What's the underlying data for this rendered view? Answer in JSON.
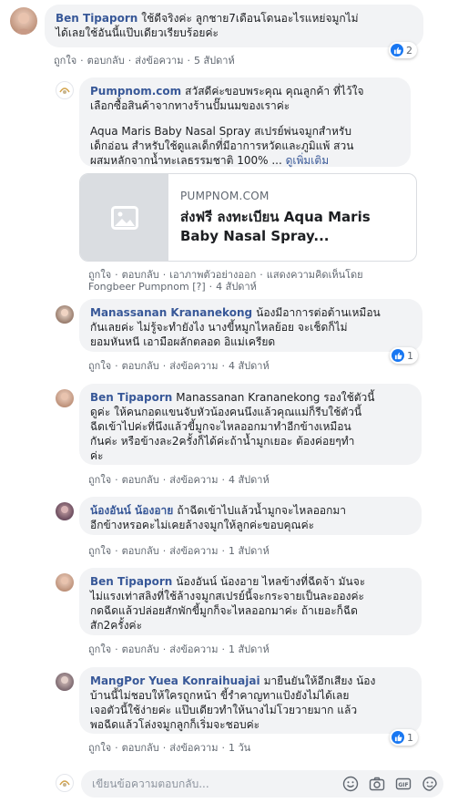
{
  "colors": {
    "link": "#385898",
    "meta": "#606770",
    "bubble": "#f2f3f5",
    "like": "#1877f2"
  },
  "actions": {
    "like": "ถูกใจ",
    "reply": "ตอบกลับ",
    "report": "ส่งข้อความ"
  },
  "comments": [
    {
      "author": "Ben Tipaporn",
      "text_lines": [
        "ใช้ดีจริงค่ะ ลูกชาย7เดือนโดนอะไรแหย่จมูกไม่",
        "ได้เลยใช้อันนี้แป๊บเดียวเรียบร้อยค่ะ"
      ],
      "time": "5 สัปดาห์",
      "reactions": "2"
    },
    {
      "author": "Pumpnom.com",
      "text_lines": [
        "สวัสดีค่ะขอบพระคุณ คุณลูกค้า ที่ไว้ใจ",
        "เลือกซื้อสินค้าจากทางร้านปั๊มนมของเราค่ะ"
      ],
      "para_lines": [
        "Aqua Maris Baby Nasal Spray สเปรย์พ่นจมูกสำหรับ",
        "เด็กอ่อน สำหรับใช้ดูแลเด็กที่มีอาการหวัดและภูมิแพ้ สวน",
        "ผสมหลักจากน้ำทะเลธรรมชาติ 100% ..."
      ],
      "see_more": "ดูเพิ่มเติม",
      "link_card": {
        "domain": "PUMPNOM.COM",
        "title_lines": [
          "ส่งฟรี ลงทะเบียน Aqua Maris",
          "Baby Nasal Spray..."
        ]
      },
      "extra_actions": {
        "preview": "เอาภาพตัวอย่างออก",
        "translate": "แสดงความคิดเห็นโดย"
      },
      "signature": "Fongbeer Pumpnom",
      "sig_tag": "[?]",
      "time": "4 สัปดาห์"
    },
    {
      "author": "Manassanan Krananekong",
      "text_lines": [
        "น้องมีอาการต่อต้านเหมือน",
        "กันเลยค่ะ ไม่รู้จะทำยังไง นางขี้หมูกไหลย้อย จะเช็ดก็ไม่",
        "ยอมหันหนี เอามือผลักตลอด อิแม่เครียด"
      ],
      "time": "4 สัปดาห์",
      "reactions": "1"
    },
    {
      "author": "Ben Tipaporn",
      "text_lines": [
        "Manassanan Krananekong รองใช้ตัวนี้",
        "ดูค่ะ ให้คนกอดแขนจับหัวน้องคนนึงแล้วคุณแม่ก็รีบใช้ตัวนี้",
        "ฉีดเข้าไปค่ะที่นึงแล้วขี้มูกจะไหลออกมาทำอีกข้างเหมือน",
        "กันค่ะ หรือข้างละ2ครั้งก็ได้ค่ะถ้าน้ำมูกเยอะ ต้องค่อยๆทำ",
        "ค่ะ"
      ],
      "time": "4 สัปดาห์"
    },
    {
      "author": "น้องอันน์ น้องอาย",
      "text_lines": [
        "ถ้าฉีดเข้าไปแล้วน้ำมูกจะไหลออกมา",
        "อีกข้างหรอคะไม่เคยล้างจมูกให้ลูกค่ะขอบคุณค่ะ"
      ],
      "time": "1 สัปดาห์"
    },
    {
      "author": "Ben Tipaporn",
      "text_lines": [
        "น้องอันน์ น้องอาย ไหลข้างที่ฉีดจ้า มันจะ",
        "ไม่แรงเท่าสลิงที่ใช้ล้างจมูกสเปรย์นี้จะกระจายเป็นละอองค่ะ",
        "กดฉีดแล้วปล่อยสักพักขี้มูกก็จะไหลออกมาค่ะ ถ้าเยอะก็ฉีด",
        "สัก2ครั้งค่ะ"
      ],
      "time": "1 สัปดาห์"
    },
    {
      "author": "MangPor Yuea Konraihuajai",
      "text_lines": [
        "มายืนยันให้อีกเสียง น้อง",
        "บ้านนี้ไม่ชอบให้ใครถูกหน้า ขี้รำคาญทาแป้งยังไม่ได้เลย",
        "เจอตัวนี้ใช้ง่ายค่ะ แป๊บเดียวทำให้นางไม่โวยวายมาก แล้ว",
        "พอฉีดแล้วโล่งจมูกลูกก็เริ่มจะชอบค่ะ"
      ],
      "time": "1 วัน",
      "reactions": "1"
    }
  ],
  "reply_box": {
    "placeholder": "เขียนข้อความตอบกลับ..."
  }
}
